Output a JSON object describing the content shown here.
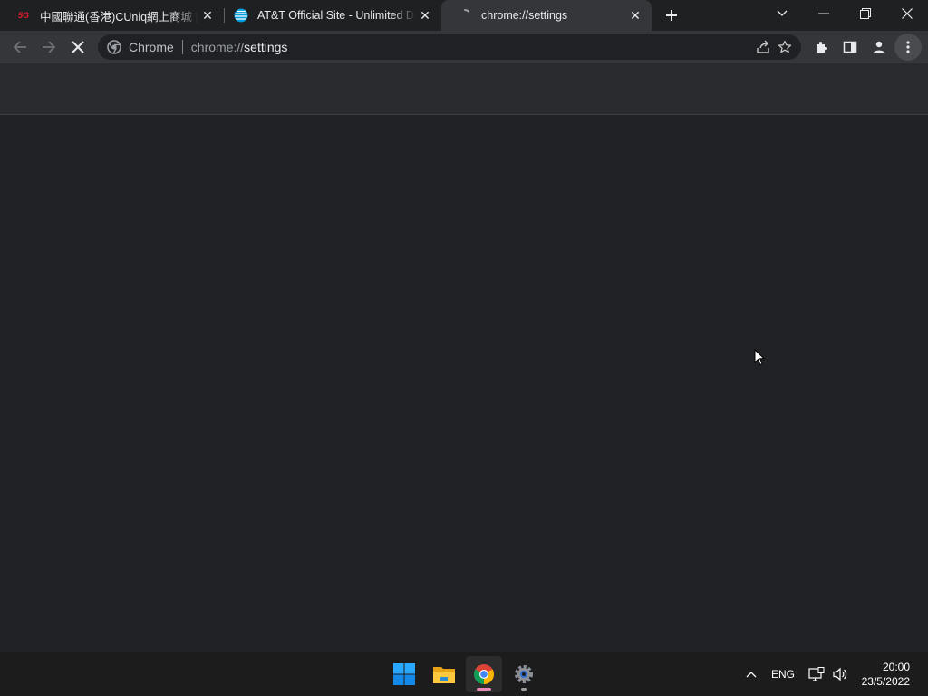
{
  "tabs": [
    {
      "title": "中國聯通(香港)CUniq網上商城 | 全",
      "favicon": "5g-logo-icon",
      "favicon_text": "5G",
      "active": false
    },
    {
      "title": "AT&T Official Site - Unlimited Data",
      "favicon": "att-globe-icon",
      "active": false
    },
    {
      "title": "chrome://settings",
      "favicon": "loading-spinner-icon",
      "active": true
    }
  ],
  "toolbar": {
    "omnibox": {
      "chip": "Chrome",
      "url_scheme": "chrome://",
      "url_host": "settings"
    }
  },
  "taskbar": {
    "tray": {
      "language": "ENG"
    },
    "clock": {
      "time": "20:00",
      "date": "23/5/2022"
    }
  },
  "colors": {
    "chrome_dark": "#35363a",
    "page_bg": "#202124",
    "header_bg": "#292a2d",
    "accent_pink": "#e88ab5",
    "win_blue": "#29a8ff"
  }
}
